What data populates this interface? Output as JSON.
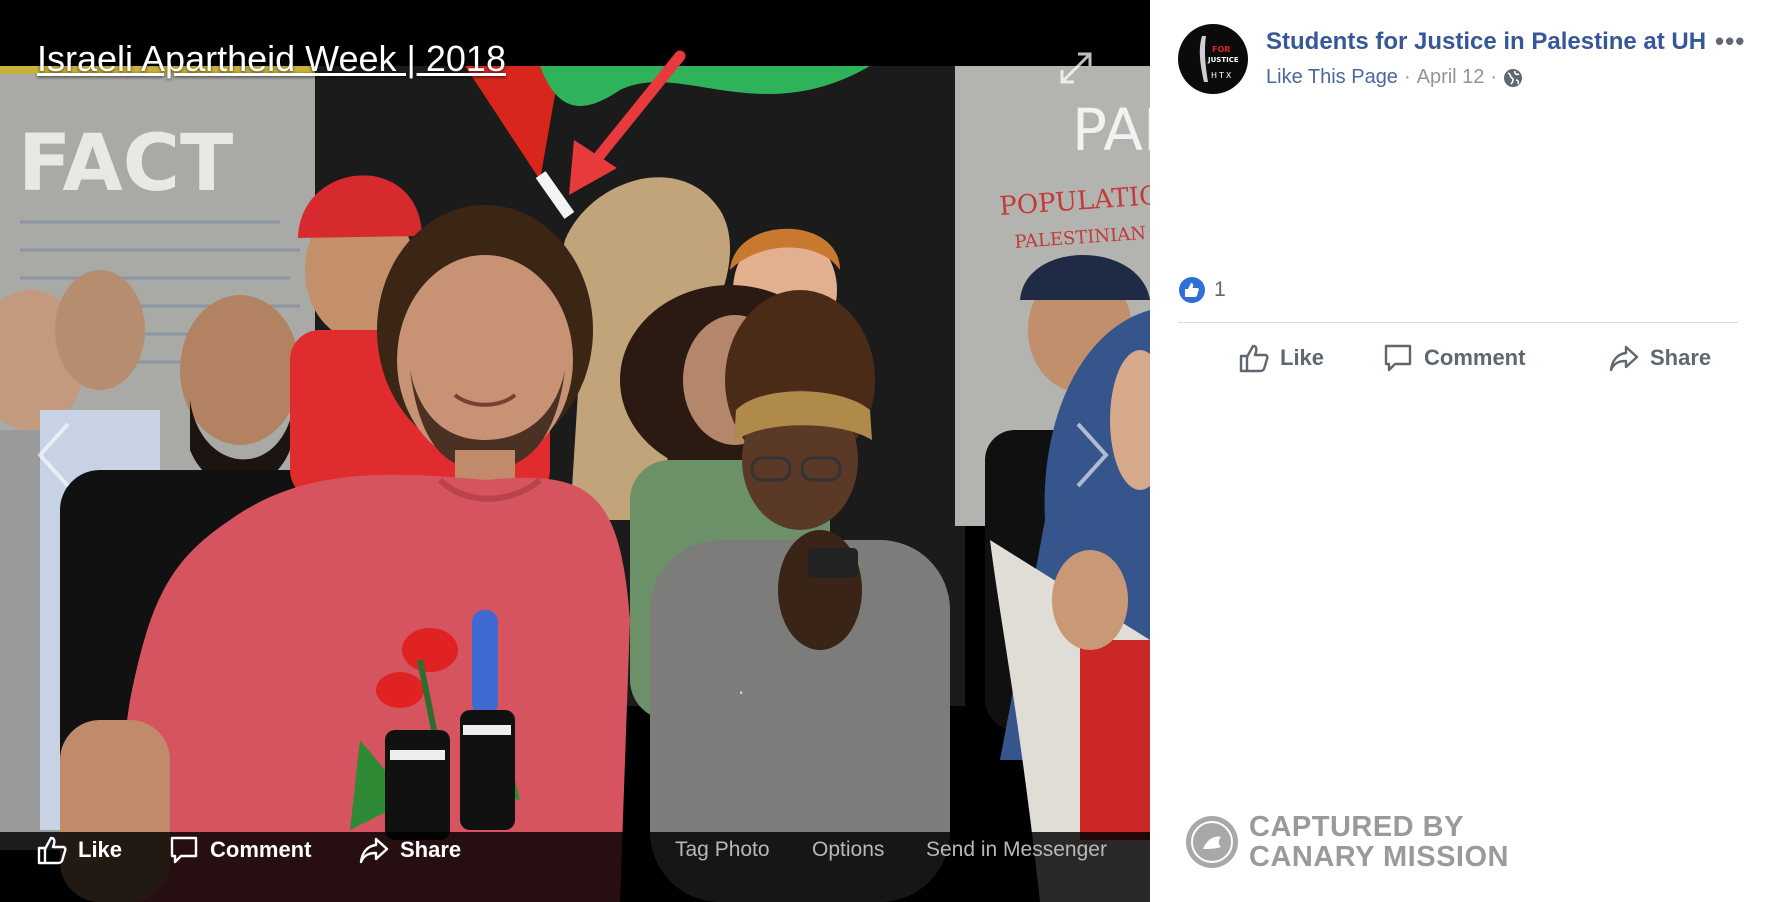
{
  "photo": {
    "title": "Israeli Apartheid Week | 2018",
    "mural_text_left": "FACT",
    "mural_text_right_1": "PAL",
    "mural_text_right_2": "POPULATION",
    "mural_text_right_3": "PALESTINIAN",
    "footer_actions": {
      "like": "Like",
      "comment": "Comment",
      "share": "Share"
    },
    "footer_links": {
      "tag": "Tag Photo",
      "options": "Options",
      "messenger": "Send in Messenger"
    }
  },
  "post": {
    "page_name": "Students for Justice in Palestine at UH",
    "more_label": "•••",
    "like_page": "Like This Page",
    "date": "April 12",
    "privacy_icon": "globe-icon",
    "reaction_count": "1",
    "actions": {
      "like": "Like",
      "comment": "Comment",
      "share": "Share"
    }
  },
  "avatar": {
    "line1": "FOR",
    "line2": "JUSTICE",
    "line3": "HTX"
  },
  "watermark": {
    "line1": "CAPTURED BY",
    "line2": "CANARY MISSION"
  },
  "colors": {
    "link": "#365899",
    "like_blue": "#2f6fd6",
    "arrow_red": "#e8393d"
  }
}
